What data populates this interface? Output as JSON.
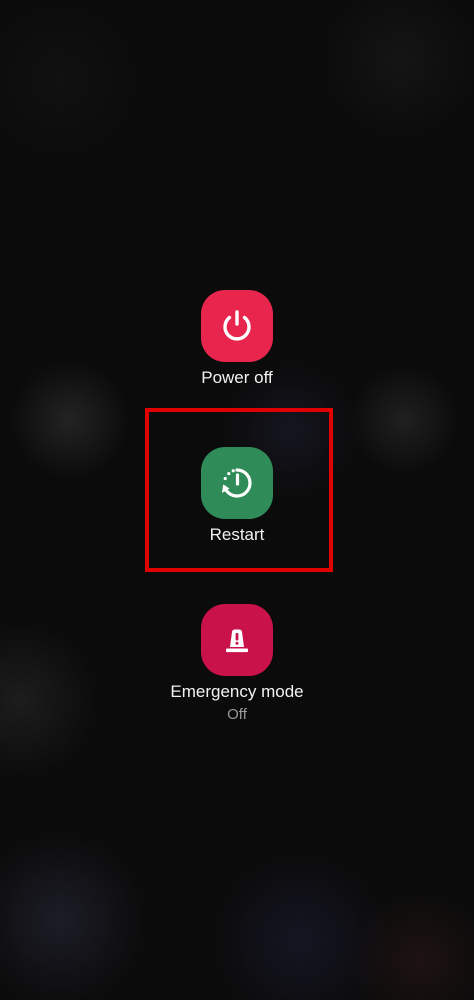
{
  "power_menu": {
    "power_off": {
      "label": "Power off",
      "icon": "power-icon",
      "color": "#e8264d"
    },
    "restart": {
      "label": "Restart",
      "icon": "restart-icon",
      "color": "#2f8b57"
    },
    "emergency_mode": {
      "label": "Emergency mode",
      "status": "Off",
      "icon": "emergency-light-icon",
      "color": "#c9124a"
    }
  },
  "highlight": {
    "color": "#e00000",
    "target": "restart"
  }
}
